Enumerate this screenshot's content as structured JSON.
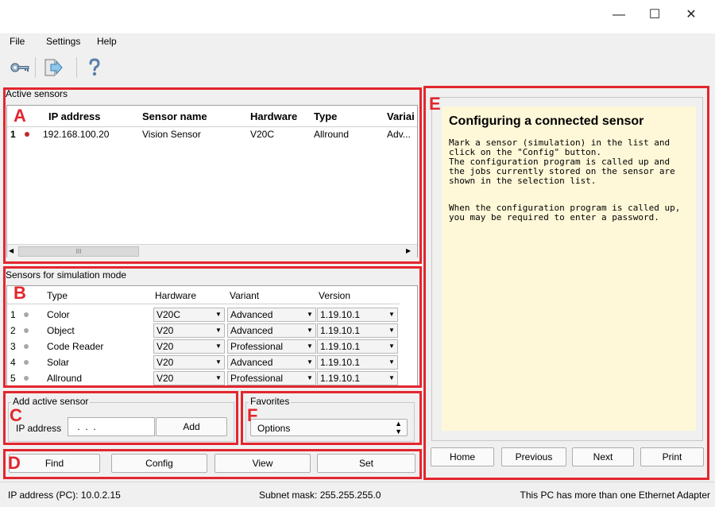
{
  "window": {
    "minimize_glyph": "—",
    "maximize_glyph": "☐",
    "close_glyph": "✕"
  },
  "menu": {
    "items": [
      "File",
      "Settings",
      "Help"
    ]
  },
  "toolbar": {
    "icons": [
      "key-icon",
      "exit-icon",
      "help-icon"
    ]
  },
  "active_sensors": {
    "group_label": "Active sensors",
    "marker": "A",
    "columns": [
      "IP address",
      "Sensor name",
      "Hardware",
      "Type",
      "Variant"
    ],
    "columns_display": [
      "IP address",
      "Sensor name",
      "Hardware",
      "Type",
      "Variai"
    ],
    "rows": [
      {
        "num": "1",
        "ip": "192.168.100.20",
        "name": "Vision Sensor",
        "hardware": "V20C",
        "type": "Allround",
        "variant": "Adv..."
      }
    ],
    "scroll_thumb_glyph": "III"
  },
  "simulation": {
    "group_label": "Sensors for simulation mode",
    "marker": "B",
    "columns": [
      "Type",
      "Hardware",
      "Variant",
      "Version"
    ],
    "rows": [
      {
        "num": "1",
        "type": "Color",
        "hardware": "V20C",
        "variant": "Advanced",
        "version": "1.19.10.1"
      },
      {
        "num": "2",
        "type": "Object",
        "hardware": "V20",
        "variant": "Advanced",
        "version": "1.19.10.1"
      },
      {
        "num": "3",
        "type": "Code Reader",
        "hardware": "V20",
        "variant": "Professional",
        "version": "1.19.10.1"
      },
      {
        "num": "4",
        "type": "Solar",
        "hardware": "V20",
        "variant": "Advanced",
        "version": "1.19.10.1"
      },
      {
        "num": "5",
        "type": "Allround",
        "hardware": "V20",
        "variant": "Professional",
        "version": "1.19.10.1"
      }
    ]
  },
  "add_sensor": {
    "group_label": "Add active sensor",
    "marker": "C",
    "ip_label": "IP address",
    "ip_value": " .  .  . ",
    "add_button": "Add"
  },
  "favorites": {
    "group_label": "Favorites",
    "marker": "F",
    "selected": "Options"
  },
  "actions": {
    "marker": "D",
    "find": "Find",
    "config": "Config",
    "view": "View",
    "set": "Set"
  },
  "help_panel": {
    "marker": "E",
    "title": "Configuring a connected sensor",
    "para1": "Mark a sensor (simulation) in the list and click on the \"Config\" button.",
    "para2": "The configuration program is called up and the jobs currently stored on the sensor are shown in the selection list.",
    "para3": "When the configuration program is called up, you may be required to enter a password.",
    "buttons": {
      "home": "Home",
      "previous": "Previous",
      "next": "Next",
      "print": "Print"
    }
  },
  "status": {
    "ip": "IP address (PC):  10.0.2.15",
    "subnet": "Subnet mask:  255.255.255.0",
    "note": "This PC has more than one Ethernet Adapter"
  },
  "colors": {
    "marker_red": "#e3262e",
    "help_bg": "#fef8d8",
    "active_dot": "#c0282c"
  }
}
